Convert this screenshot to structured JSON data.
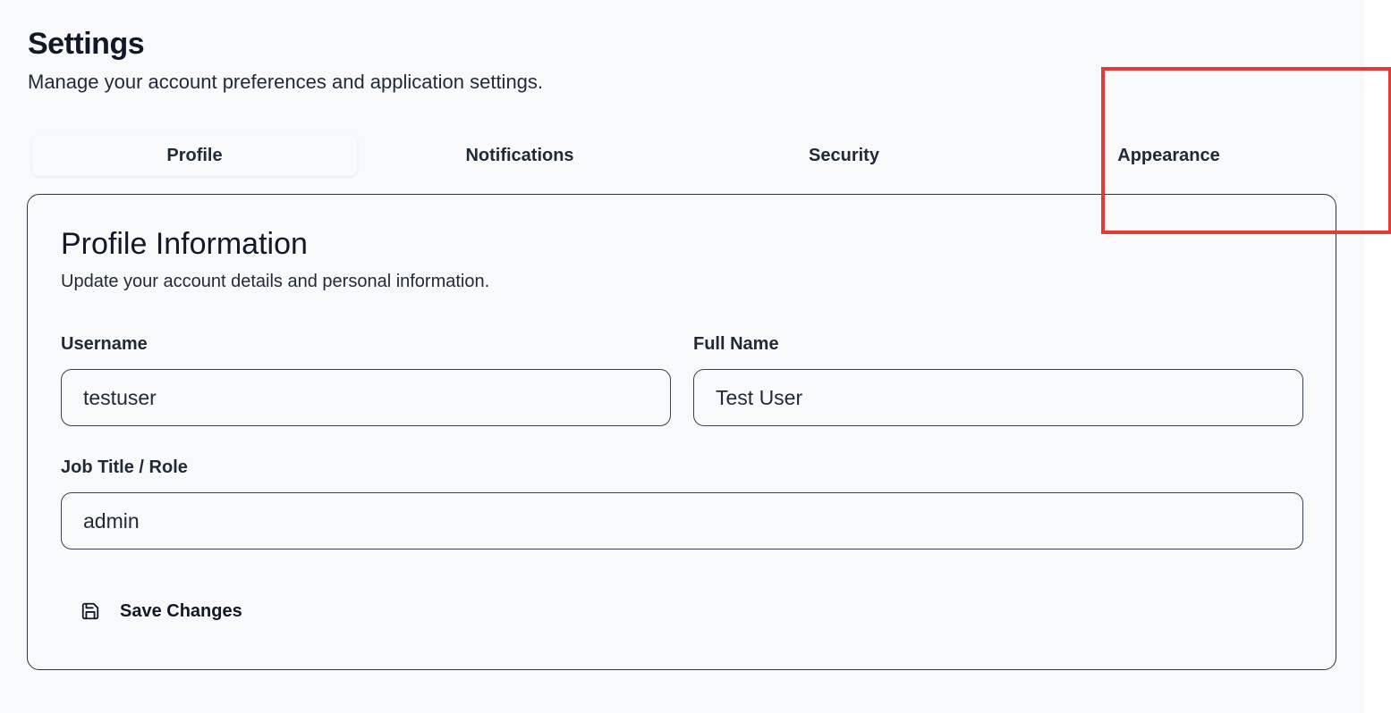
{
  "header": {
    "title": "Settings",
    "subtitle": "Manage your account preferences and application settings."
  },
  "tabs": [
    {
      "label": "Profile",
      "active": true
    },
    {
      "label": "Notifications",
      "active": false
    },
    {
      "label": "Security",
      "active": false
    },
    {
      "label": "Appearance",
      "active": false
    }
  ],
  "profile_card": {
    "title": "Profile Information",
    "subtitle": "Update your account details and personal information.",
    "fields": {
      "username": {
        "label": "Username",
        "value": "testuser"
      },
      "full_name": {
        "label": "Full Name",
        "value": "Test User"
      },
      "job_title": {
        "label": "Job Title / Role",
        "value": "admin"
      }
    },
    "save_button": {
      "label": "Save Changes",
      "icon": "save-icon"
    }
  },
  "colors": {
    "page_background": "#f8f9fb",
    "text_primary": "#111827",
    "border": "#374151",
    "highlight": "#e53935"
  }
}
